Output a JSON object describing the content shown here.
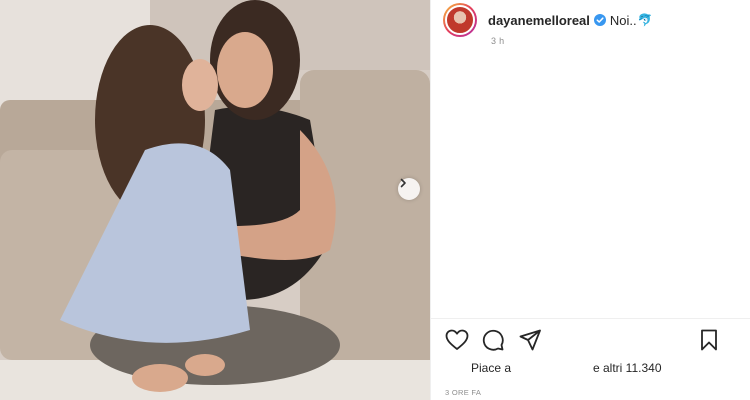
{
  "post": {
    "username": "dayanemelloreal",
    "caption": "Noi..",
    "caption_emoji": "🐬",
    "time_ago": "3 h",
    "likes_prefix": "Piace a",
    "likes_suffix": "e altri 11.340",
    "timestamp": "3 ORE FA"
  },
  "icons": {
    "avatar": "avatar-image",
    "verified": "verified-badge-icon",
    "next": "chevron-right-icon",
    "like": "heart-outline-icon",
    "comment": "comment-bubble-icon",
    "share": "paper-plane-icon",
    "save": "bookmark-outline-icon"
  },
  "colors": {
    "verified": "#3897f0",
    "text": "#262626",
    "muted": "#8e8e8e"
  }
}
